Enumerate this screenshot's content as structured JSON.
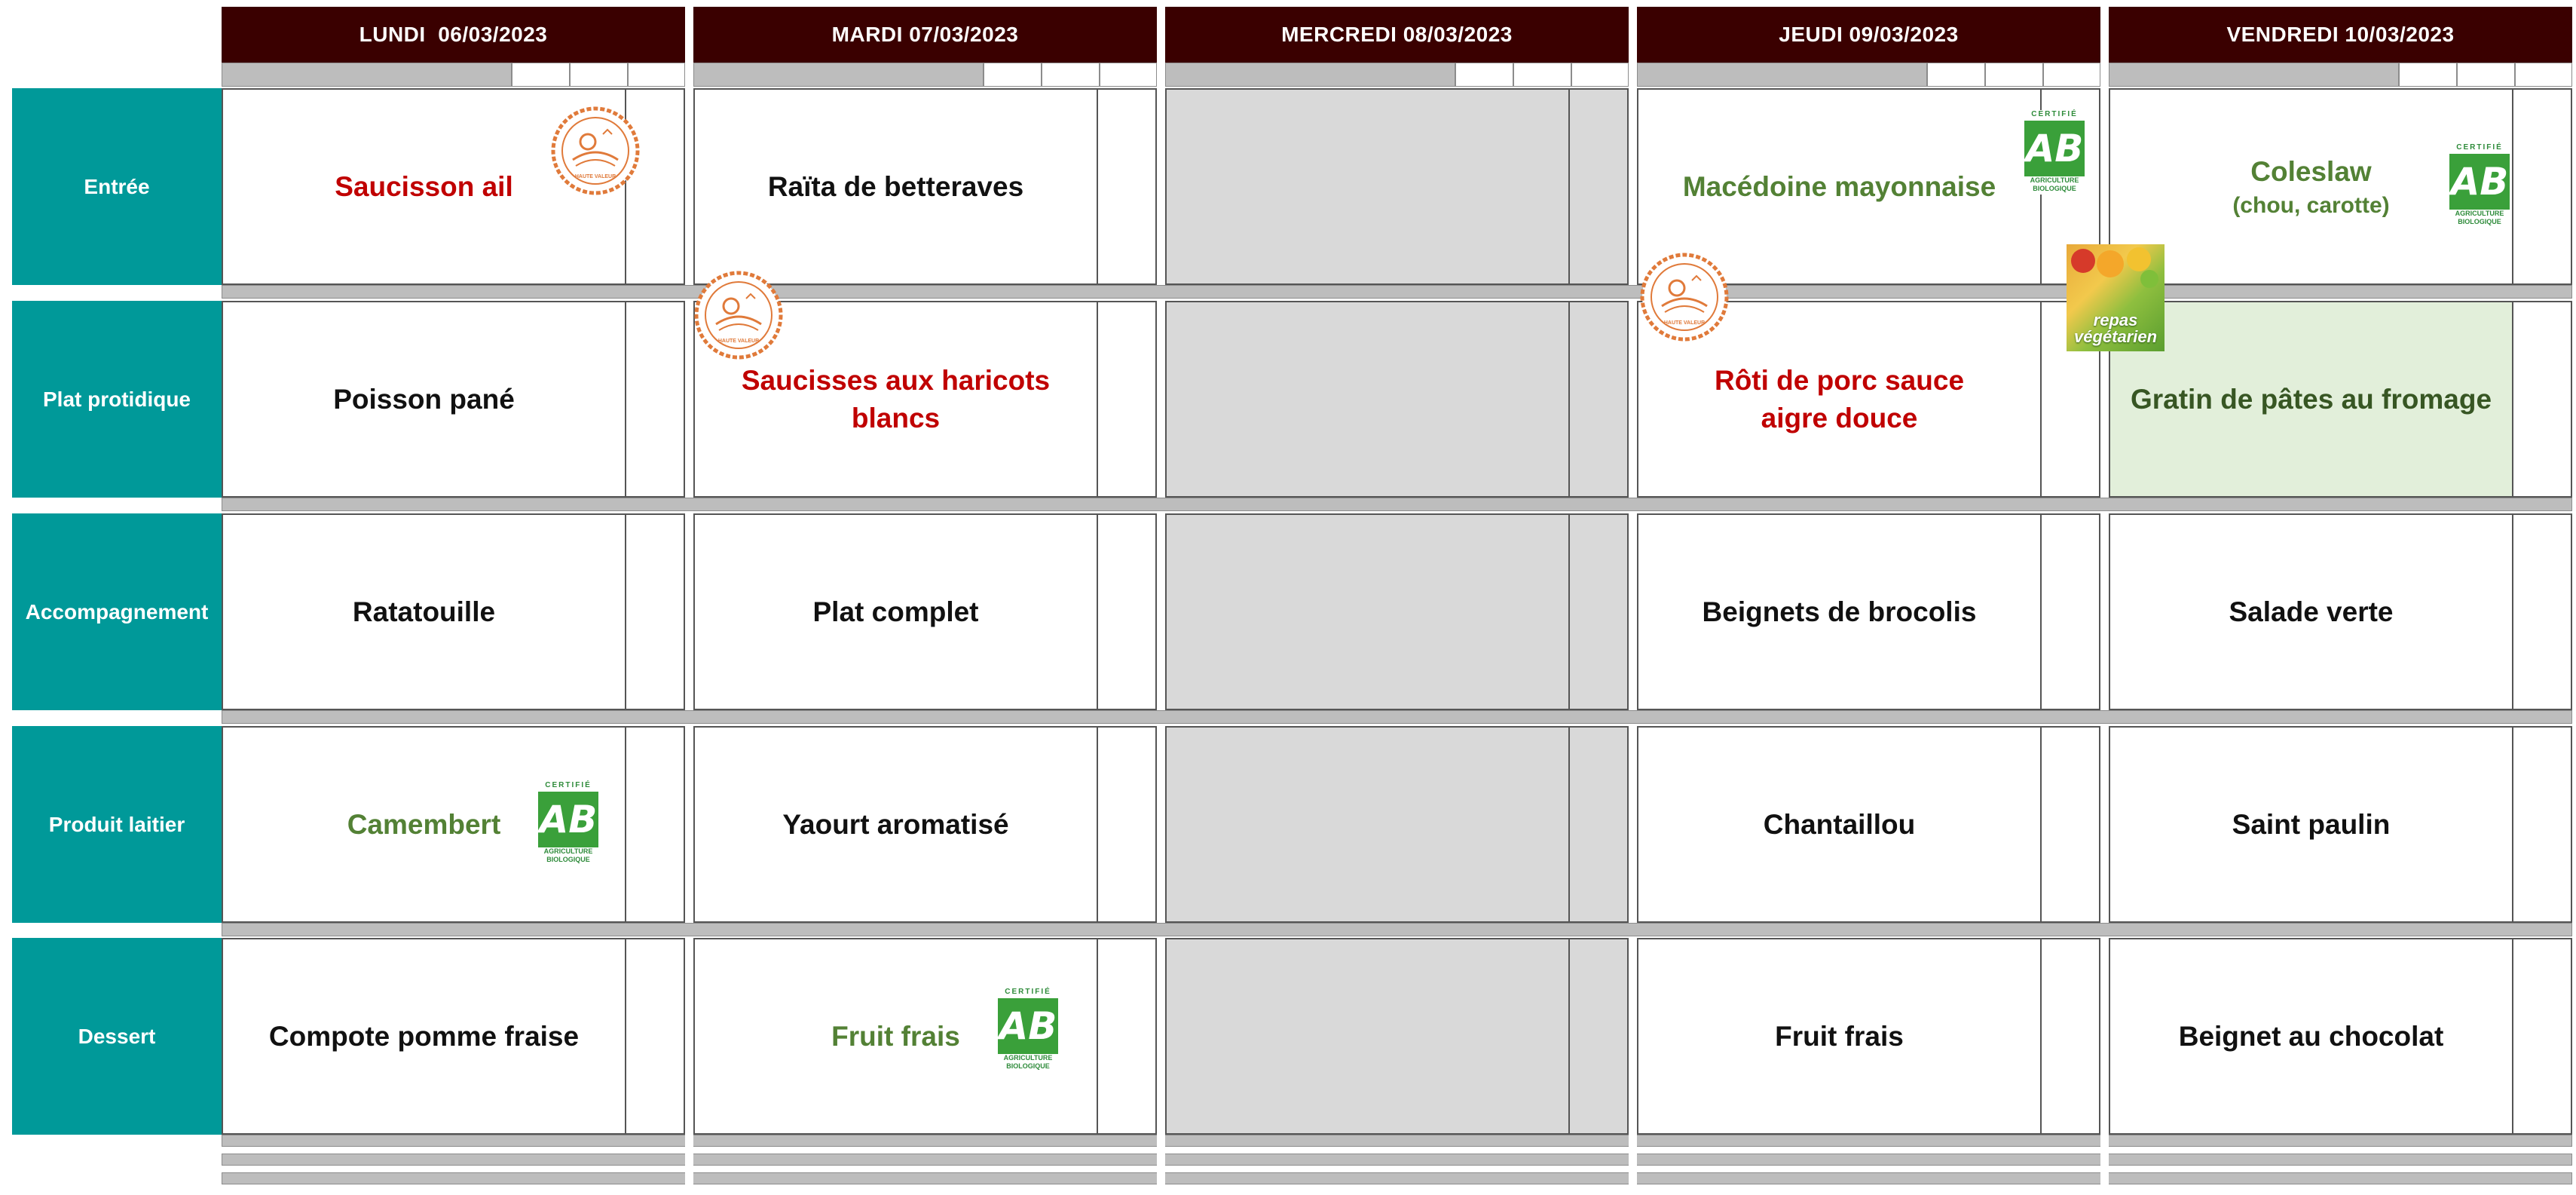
{
  "days": [
    {
      "label": "LUNDI  06/03/2023"
    },
    {
      "label": "MARDI 07/03/2023"
    },
    {
      "label": "MERCREDI 08/03/2023"
    },
    {
      "label": "JEUDI 09/03/2023"
    },
    {
      "label": "VENDREDI 10/03/2023"
    }
  ],
  "rows": [
    {
      "label": "Entrée"
    },
    {
      "label": "Plat protidique"
    },
    {
      "label": "Accompagnement"
    },
    {
      "label": "Produit laitier"
    },
    {
      "label": "Dessert"
    }
  ],
  "menu": {
    "lundi": {
      "entree": "Saucisson ail",
      "plat": "Poisson pané",
      "accompagnement": "Ratatouille",
      "laitier": "Camembert",
      "dessert": "Compote pomme fraise"
    },
    "mardi": {
      "entree": "Raïta de betteraves",
      "plat": "Saucisses aux haricots blancs",
      "accompagnement": "Plat complet",
      "laitier": "Yaourt aromatisé",
      "dessert": "Fruit frais"
    },
    "jeudi": {
      "entree": "Macédoine mayonnaise",
      "plat": "Rôti de porc sauce aigre douce",
      "accompagnement": "Beignets de brocolis",
      "laitier": "Chantaillou",
      "dessert": "Fruit frais"
    },
    "vendredi": {
      "entree": "Coleslaw",
      "entree_sub": "(chou, carotte)",
      "plat": "Gratin de pâtes au fromage",
      "accompagnement": "Salade verte",
      "laitier": "Saint paulin",
      "dessert": "Beignet au chocolat"
    }
  },
  "labels": {
    "ab_top": "CERTIFIÉ",
    "ab_mark": "AB",
    "ab_bottom1": "AGRICULTURE",
    "ab_bottom2": "BIOLOGIQUE",
    "hve_text": "HAUTE VALEUR ENVIRONNEMENTALE",
    "veg_line1": "repas",
    "veg_line2": "végétarien"
  },
  "colors": {
    "header_bg": "#3a0000",
    "row_label_bg": "#009999",
    "meat_red": "#c00000",
    "bio_green": "#538135",
    "veg_bg": "#e2efda",
    "hve_orange": "#e07a3a"
  },
  "icons": [
    "haute-valeur-environnementale-icon",
    "agriculture-biologique-icon",
    "repas-vegetarien-icon"
  ]
}
